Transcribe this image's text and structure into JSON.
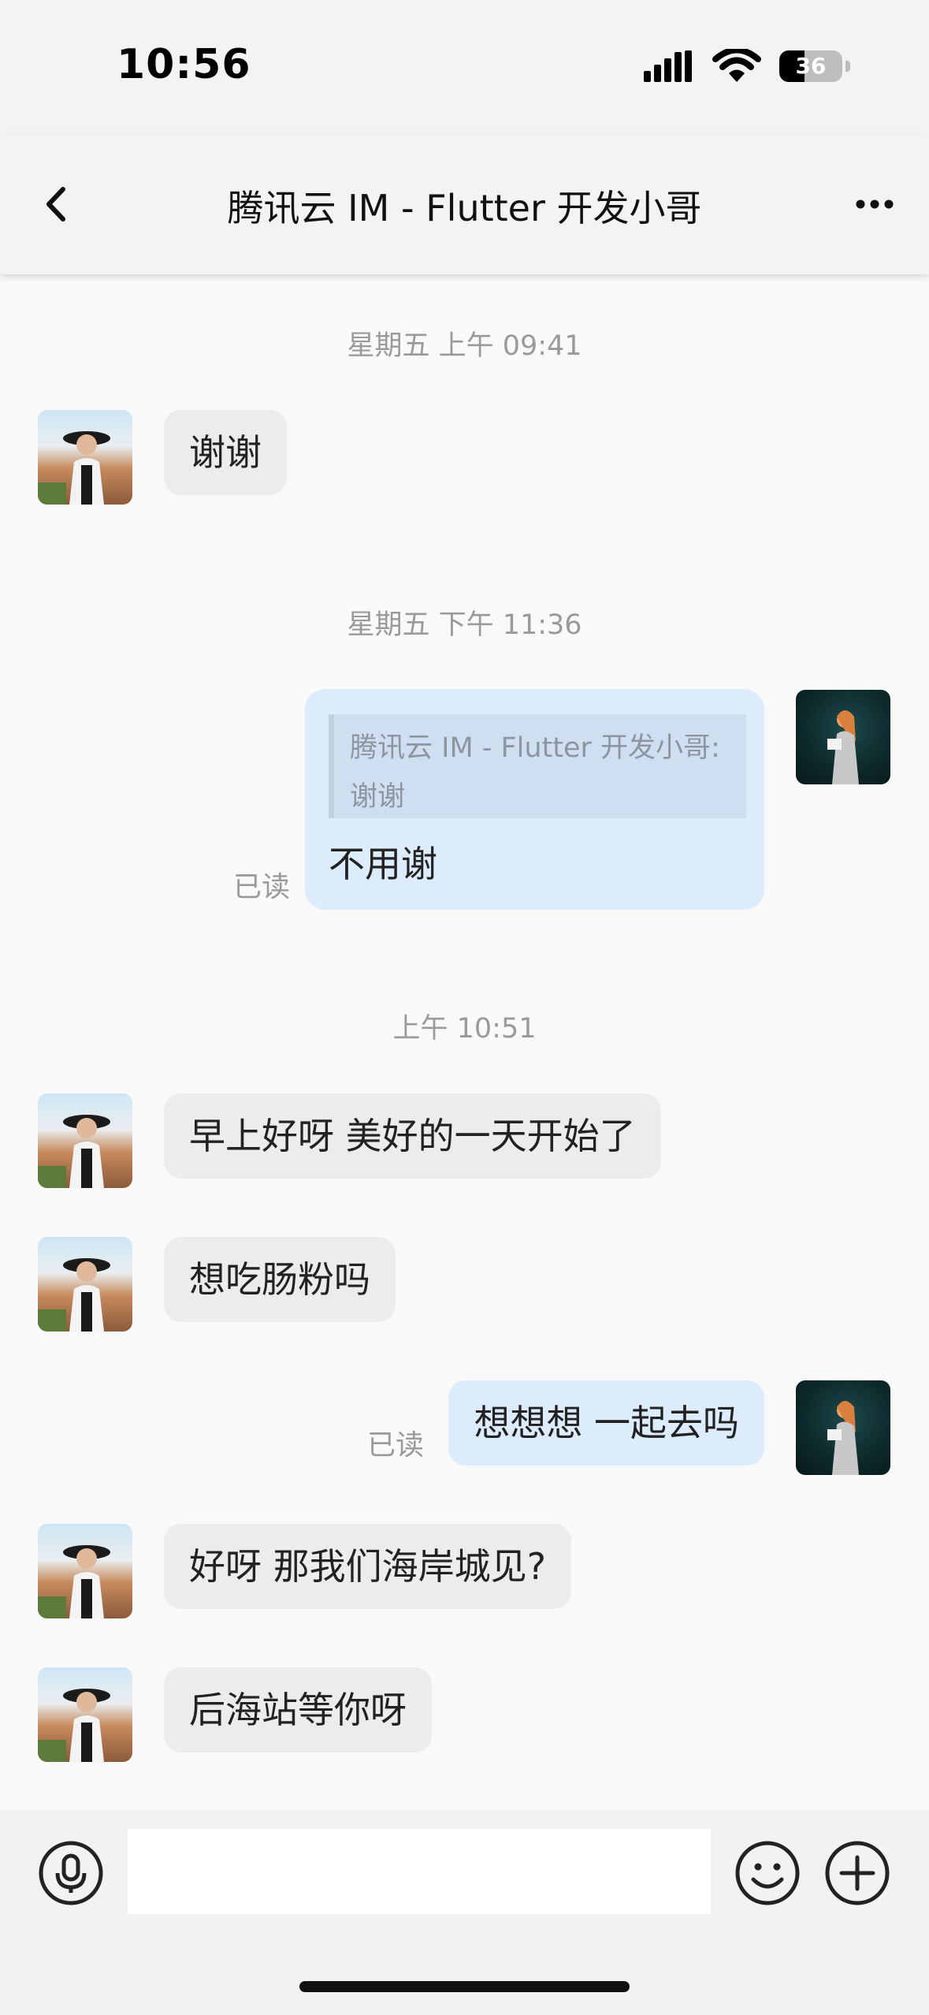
{
  "status_bar": {
    "time": "10:56",
    "battery": "36"
  },
  "nav": {
    "title": "腾讯云 IM - Flutter 开发小哥"
  },
  "timestamps": [
    "星期五 上午 09:41",
    "星期五 下午 11:36",
    "上午 10:51"
  ],
  "messages": [
    {
      "side": "left",
      "text": "谢谢"
    },
    {
      "side": "right",
      "quote": {
        "line1": "腾讯云 IM - Flutter 开发小哥:",
        "line2": "谢谢"
      },
      "text": "不用谢",
      "status": "已读"
    },
    {
      "side": "left",
      "text": "早上好呀 美好的一天开始了"
    },
    {
      "side": "left",
      "text": "想吃肠粉吗"
    },
    {
      "side": "right",
      "text": "想想想 一起去吗",
      "status": "已读"
    },
    {
      "side": "left",
      "text": "好呀 那我们海岸城见?"
    },
    {
      "side": "left",
      "text": "后海站等你呀"
    }
  ],
  "input": {
    "value": "",
    "placeholder": ""
  },
  "colors": {
    "bubble_self": "#dcecfd",
    "bubble_other": "#ececec",
    "header_bg": "#f2f3f5",
    "muted_text": "#9a9a9a"
  },
  "icons": {
    "back": "chevron-left-icon",
    "more": "more-dots-icon",
    "mic": "microphone-icon",
    "emoji": "smiley-icon",
    "plus": "plus-circle-icon"
  }
}
